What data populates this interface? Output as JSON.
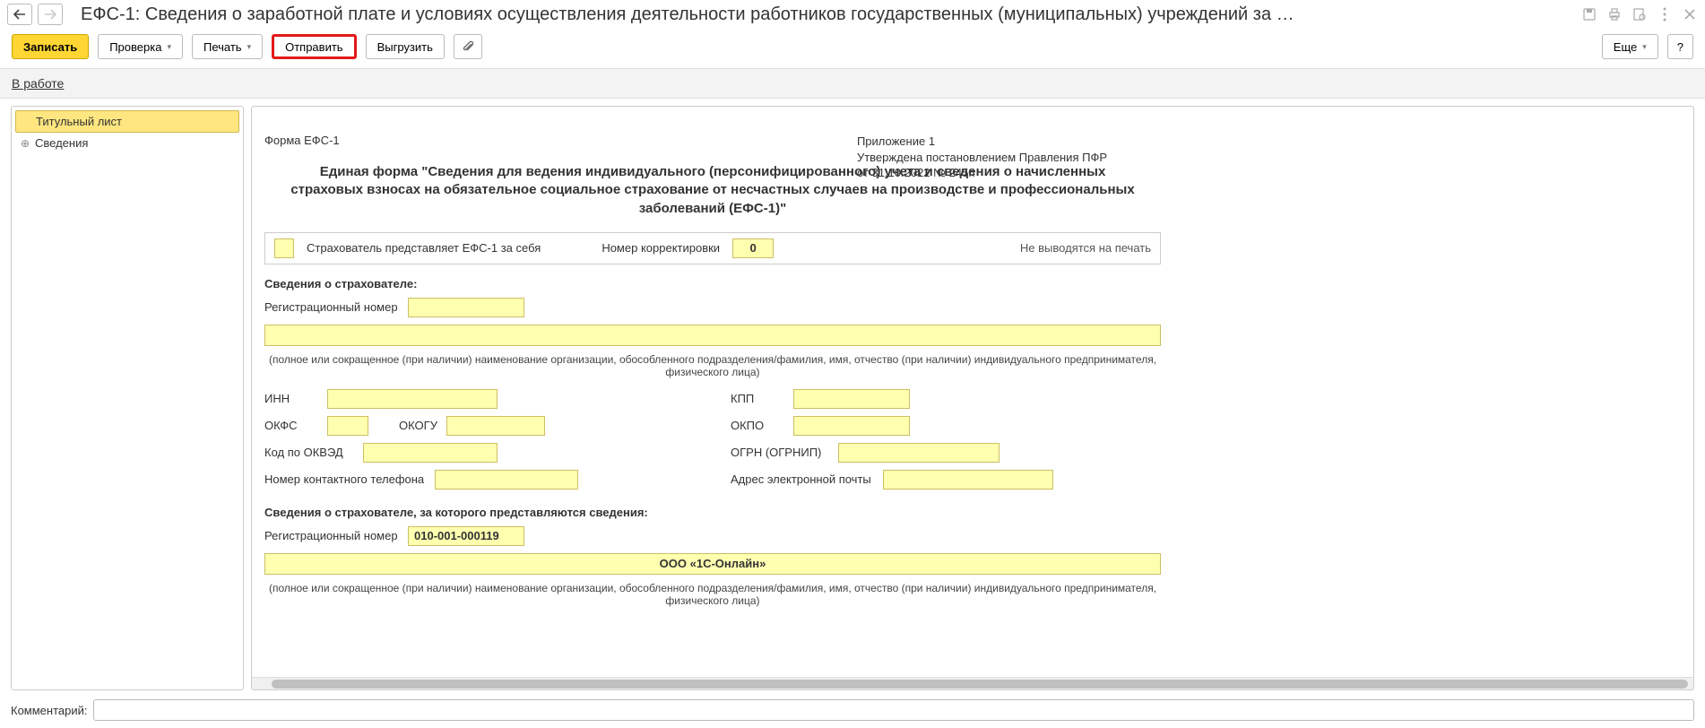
{
  "titlebar": {
    "title": "ЕФС-1: Сведения о заработной плате и условиях осуществления деятельности работников государственных (муниципальных) учреждений за …"
  },
  "toolbar": {
    "save": "Записать",
    "check": "Проверка",
    "print": "Печать",
    "send": "Отправить",
    "export": "Выгрузить",
    "more": "Еще",
    "help": "?"
  },
  "status": {
    "in_work": "В работе"
  },
  "sidebar": {
    "items": [
      {
        "label": "Титульный лист"
      },
      {
        "label": "Сведения"
      }
    ]
  },
  "form": {
    "form_code": "Форма ЕФС-1",
    "appendix_line1": "Приложение 1",
    "appendix_line2": "Утверждена постановлением Правления ПФР",
    "appendix_line3": "от 31.10.2022 № 245п",
    "title": "Единая форма \"Сведения для ведения индивидуального (персонифицированного) учета и сведения о начисленных страховых взносах на обязательное социальное страхование от несчастных случаев на производстве и профессиональных заболеваний (ЕФС-1)\"",
    "self_insurer_label": "Страхователь представляет ЕФС-1 за себя",
    "corr_num_label": "Номер корректировки",
    "corr_num_value": "0",
    "no_print": "Не выводятся на печать",
    "section_insurer": "Сведения о страхователе:",
    "reg_num_label": "Регистрационный номер",
    "org_name_hint": "(полное или сокращенное (при наличии) наименование организации, обособленного подразделения/фамилия, имя, отчество (при наличии) индивидуального предпринимателя, физического лица)",
    "inn_label": "ИНН",
    "kpp_label": "КПП",
    "okfs_label": "ОКФС",
    "okogu_label": "ОКОГУ",
    "okpo_label": "ОКПО",
    "okved_label": "Код по ОКВЭД",
    "ogrn_label": "ОГРН (ОГРНИП)",
    "phone_label": "Номер контактного телефона",
    "email_label": "Адрес электронной почты",
    "section_insurer2": "Сведения о страхователе, за которого представляются сведения:",
    "reg_num2_value": "010-001-000119",
    "org2_name": "ООО «1С-Онлайн»"
  },
  "comment": {
    "label": "Комментарий:",
    "value": ""
  }
}
